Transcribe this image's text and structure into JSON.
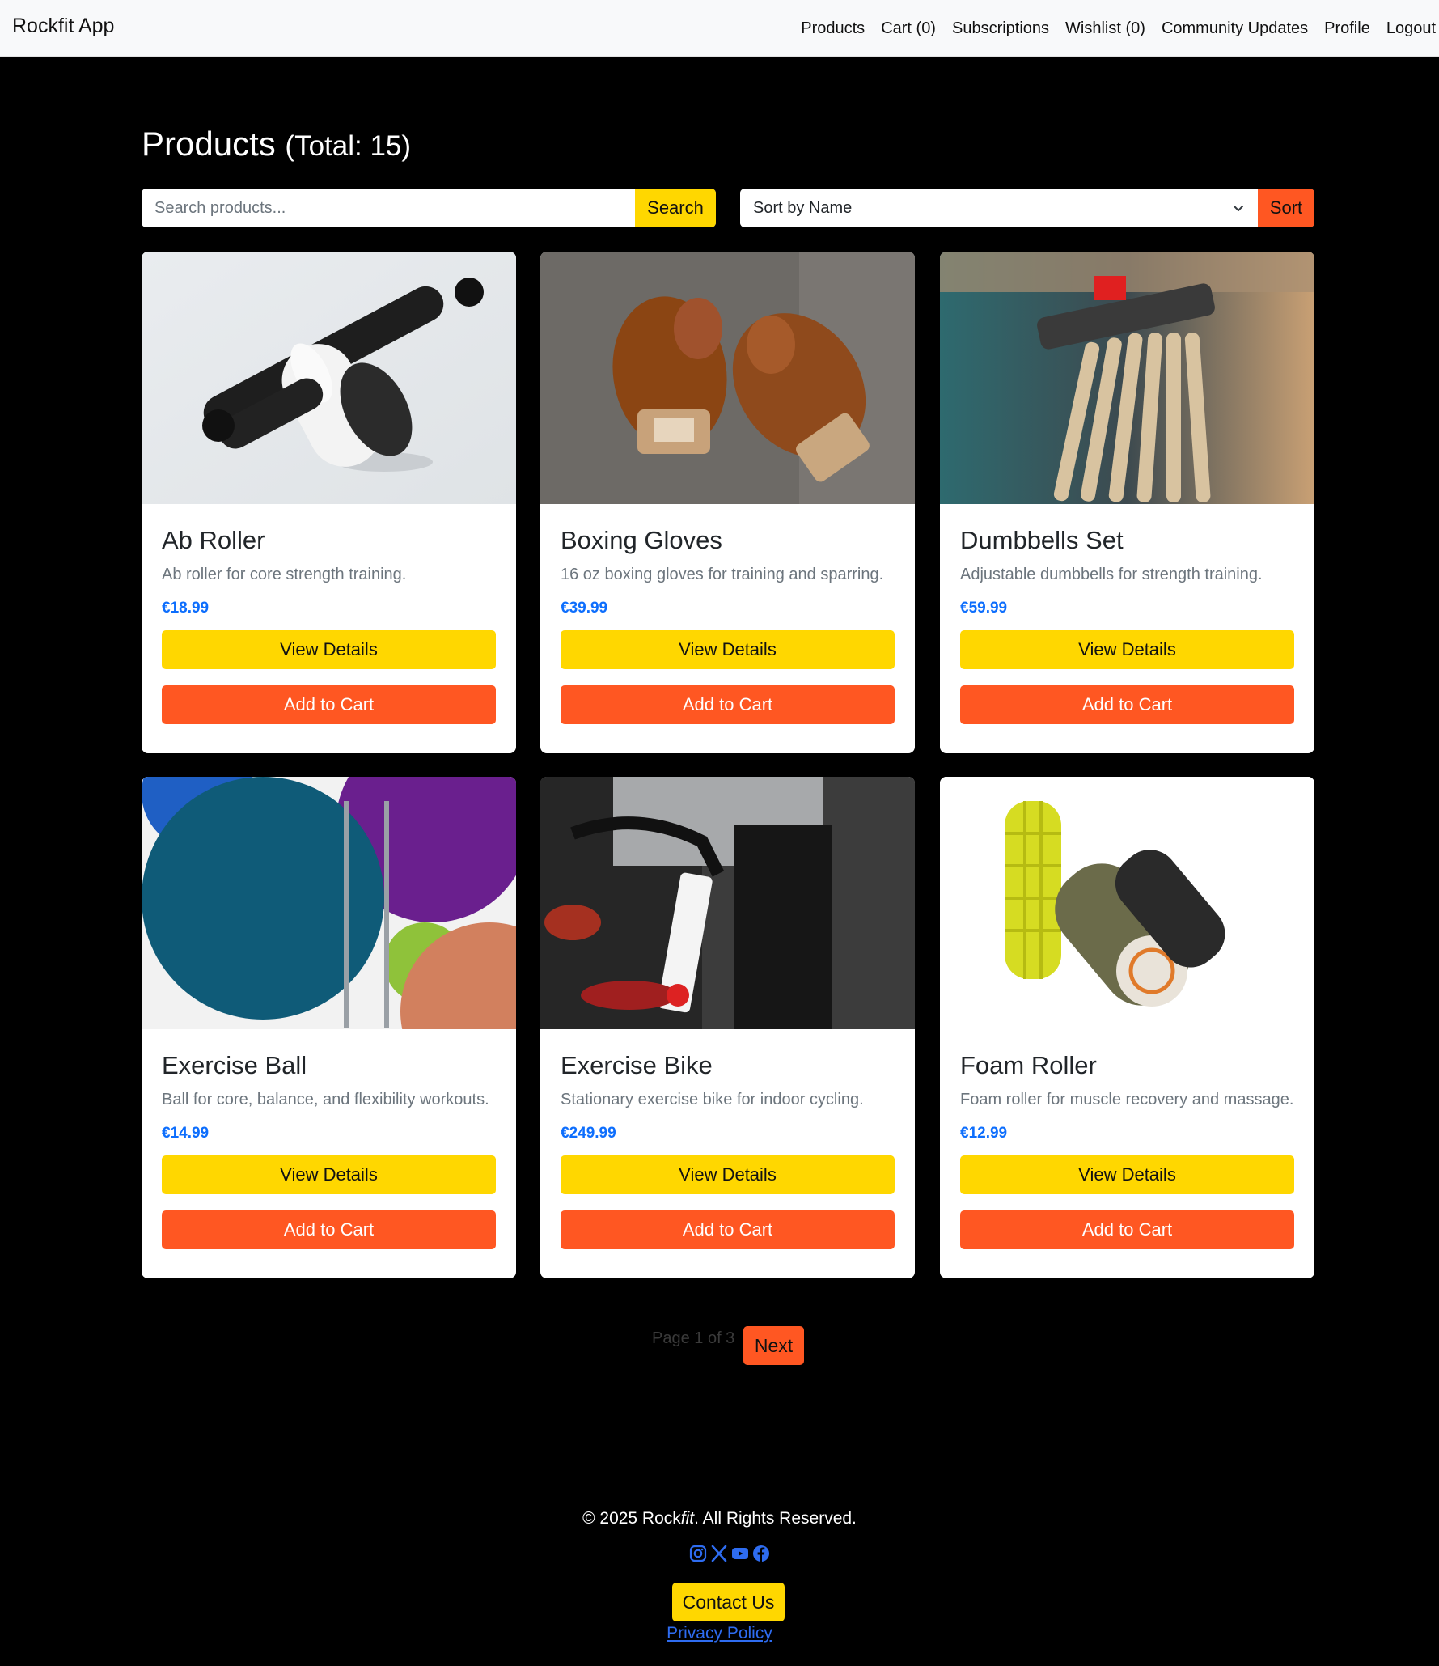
{
  "navbar": {
    "brand": "Rockfit App",
    "links": [
      "Products",
      "Cart (0)",
      "Subscriptions",
      "Wishlist (0)",
      "Community Updates",
      "Profile",
      "Logout"
    ]
  },
  "header": {
    "title": "Products",
    "total": "(Total: 15)"
  },
  "search": {
    "placeholder": "Search products...",
    "value": "",
    "button_label": "Search"
  },
  "sort": {
    "selected": "Sort by Name",
    "button_label": "Sort"
  },
  "products": [
    {
      "name": "Ab Roller",
      "description": "Ab roller for core strength training.",
      "price": "€18.99",
      "image": "ab-roller-photo"
    },
    {
      "name": "Boxing Gloves",
      "description": "16 oz boxing gloves for training and sparring.",
      "price": "€39.99",
      "image": "boxing-gloves-photo"
    },
    {
      "name": "Dumbbells Set",
      "description": "Adjustable dumbbells for strength training.",
      "price": "€59.99",
      "image": "dumbbells-photo"
    },
    {
      "name": "Exercise Ball",
      "description": "Ball for core, balance, and flexibility workouts.",
      "price": "€14.99",
      "image": "exercise-ball-photo"
    },
    {
      "name": "Exercise Bike",
      "description": "Stationary exercise bike for indoor cycling.",
      "price": "€249.99",
      "image": "exercise-bike-photo"
    },
    {
      "name": "Foam Roller",
      "description": "Foam roller for muscle recovery and massage.",
      "price": "€12.99",
      "image": "foam-roller-photo"
    }
  ],
  "card_buttons": {
    "details_label": "View Details",
    "cart_label": "Add to Cart"
  },
  "pagination": {
    "info": "Page 1 of 3",
    "next_label": "Next"
  },
  "footer": {
    "copyright_prefix": "© 2025 Rock",
    "copyright_italic": "fit",
    "copyright_suffix": ". All Rights Reserved.",
    "socials": [
      "instagram-icon",
      "x-icon",
      "youtube-icon",
      "facebook-icon"
    ],
    "contact_label": "Contact Us",
    "privacy_label": "Privacy Policy"
  },
  "colors": {
    "accent_yellow": "#ffd700",
    "accent_orange": "#ff5722",
    "price_blue": "#0d6efd",
    "background": "#000000"
  }
}
